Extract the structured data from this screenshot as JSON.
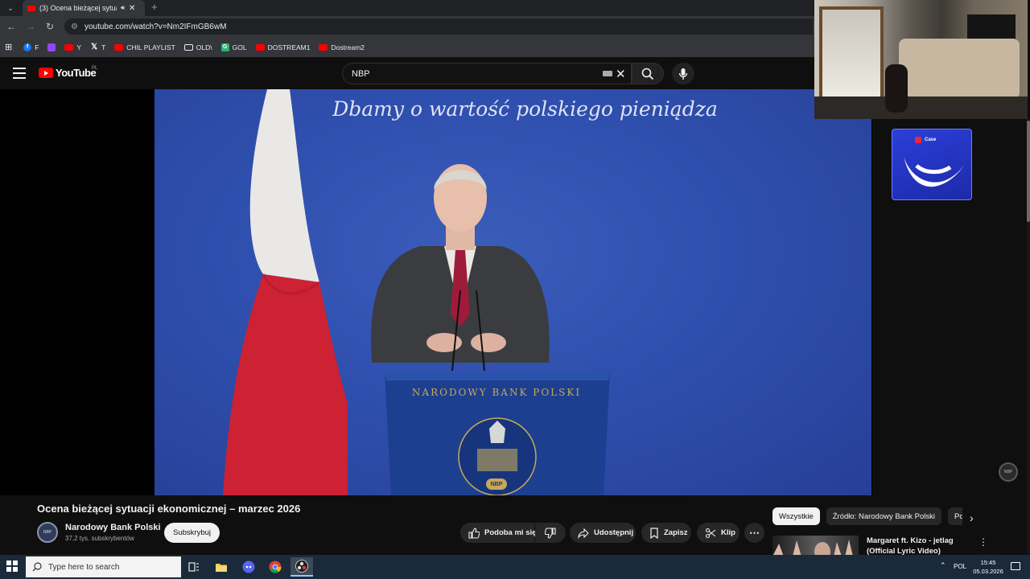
{
  "browser": {
    "tab": {
      "title": "(3) Ocena bieżącej sytuacji ekonomicznej – marzec 2026 - YouTube"
    },
    "address": {
      "url": "youtube.com/watch?v=Nm2IFmGB6wM"
    },
    "bookmarks": [
      {
        "label": "F",
        "icon_color": "#1877f2"
      },
      {
        "label": "",
        "icon_color": "#9146ff"
      },
      {
        "label": "Y",
        "icon_color": "#ff0000"
      },
      {
        "label": "T",
        "icon_color": "#000000"
      },
      {
        "label": "CHIL PLAYLIST",
        "icon_color": "#ff0000"
      },
      {
        "label": "OLD\\",
        "icon_color": "folder"
      },
      {
        "label": "GOL",
        "icon_color": "#2bb673"
      },
      {
        "label": "DOSTREAM1",
        "icon_color": "#ff0000"
      },
      {
        "label": "Dostream2",
        "icon_color": "#ff0000"
      }
    ]
  },
  "youtube": {
    "logo": "YouTube",
    "country": "PL",
    "search": {
      "value": "NBP"
    }
  },
  "video": {
    "slogan": "Dbamy o wartość polskiego pieniądza",
    "podium_seal": "NARODOWY BANK POLSKI",
    "podium_badge": "NBP",
    "watermark": "NBP"
  },
  "overlay": {
    "brand": "Case"
  },
  "watch": {
    "title": "Ocena bieżącej sytuacji ekonomicznej – marzec 2026",
    "channel": {
      "name": "Narodowy Bank Polski",
      "subscribers": "37,2 tys. subskrybentów",
      "avatar": "NBP",
      "subscribe_label": "Subskrybuj"
    },
    "actions": {
      "like": "Podoba mi się",
      "share": "Udostępnij",
      "save": "Zapisz",
      "clip": "Klip"
    }
  },
  "related": {
    "chips": [
      "Wszystkie",
      "Źródło: Narodowy Bank Polski",
      "Po"
    ],
    "first": {
      "title": "Margaret ft. Kizo - jetlag (Official Lyric Video)"
    }
  },
  "taskbar": {
    "search_placeholder": "Type here to search",
    "lang": "POL",
    "time": "15:45",
    "date": "05.03.2026"
  }
}
